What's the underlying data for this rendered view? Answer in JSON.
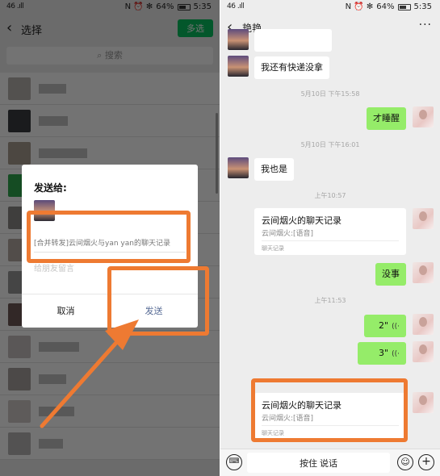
{
  "status": {
    "signal": "46 .ıll",
    "icons": "N ⏰ ✻",
    "battery": "64%",
    "time": "5:35"
  },
  "left": {
    "title": "选择",
    "multi_select": "多选",
    "search_placeholder": "搜索",
    "dialog": {
      "title": "发送给:",
      "message": "[合并转发]云间烟火与yan yan的聊天记录",
      "placeholder": "给朋友留言",
      "cancel": "取消",
      "send": "发送"
    }
  },
  "right": {
    "title": "艳艳",
    "messages": {
      "m1": "我还有快递没拿",
      "ts1": "5月10日 下午15:58",
      "m2": "才睡醒",
      "ts2": "5月10日 下午16:01",
      "m3": "我也是",
      "ts3": "上午10:57",
      "card1_title": "云间烟火的聊天记录",
      "card1_sub": "云间烟火:[语音]",
      "card1_foot": "聊天记录",
      "m4": "没事",
      "ts4": "上午11:53",
      "voice1": "2\"",
      "voice2": "3\"",
      "card2_title": "云间烟火的聊天记录",
      "card2_sub": "云间烟火:[语音]",
      "card2_foot": "聊天记录"
    },
    "hold_to_talk": "按住 说话"
  },
  "colors": {
    "wechat_green": "#07c160",
    "bubble_green": "#95ec69",
    "highlight_orange": "#ee7a32",
    "send_blue": "#576b95"
  }
}
